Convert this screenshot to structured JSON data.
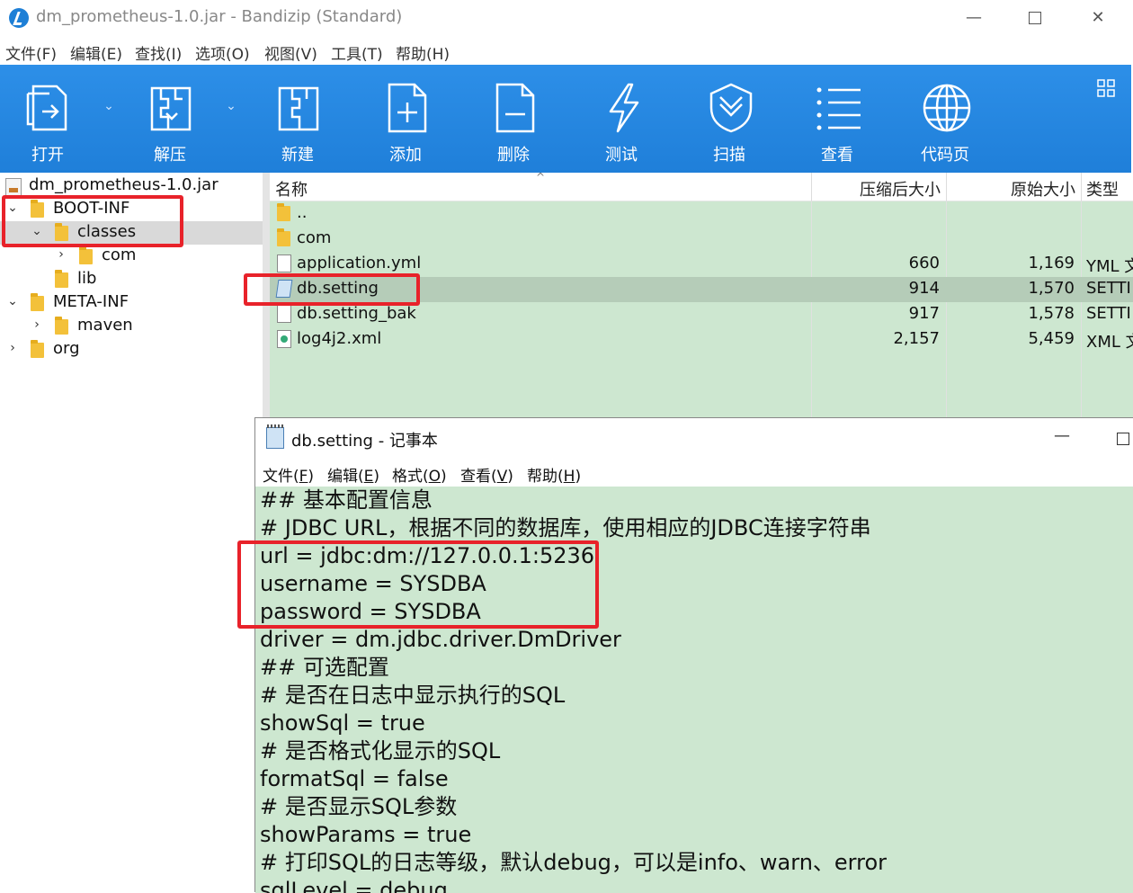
{
  "window": {
    "title": "dm_prometheus-1.0.jar - Bandizip (Standard)",
    "minimize": "—",
    "close": "✕"
  },
  "menu": [
    "文件(F)",
    "编辑(E)",
    "查找(I)",
    "选项(O)",
    "视图(V)",
    "工具(T)",
    "帮助(H)"
  ],
  "toolbar": {
    "open": "打开",
    "extract": "解压",
    "new": "新建",
    "add": "添加",
    "delete": "删除",
    "test": "测试",
    "scan": "扫描",
    "view": "查看",
    "codepage": "代码页",
    "dropdown": "⌄"
  },
  "tree": {
    "root": "dm_prometheus-1.0.jar",
    "items": [
      {
        "label": "BOOT-INF"
      },
      {
        "label": "classes"
      },
      {
        "label": "com"
      },
      {
        "label": "lib"
      },
      {
        "label": "META-INF"
      },
      {
        "label": "maven"
      },
      {
        "label": "org"
      }
    ]
  },
  "filelist": {
    "headers": {
      "name": "名称",
      "compressed": "压缩后大小",
      "original": "原始大小",
      "type": "类型"
    },
    "rows": [
      {
        "name": "..",
        "compressed": "",
        "original": "",
        "type": ""
      },
      {
        "name": "com",
        "compressed": "",
        "original": "",
        "type": ""
      },
      {
        "name": "application.yml",
        "compressed": "660",
        "original": "1,169",
        "type": "YML 文"
      },
      {
        "name": "db.setting",
        "compressed": "914",
        "original": "1,570",
        "type": "SETTI"
      },
      {
        "name": "db.setting_bak",
        "compressed": "917",
        "original": "1,578",
        "type": "SETTI"
      },
      {
        "name": "log4j2.xml",
        "compressed": "2,157",
        "original": "5,459",
        "type": "XML 文"
      }
    ]
  },
  "notepad": {
    "title": "db.setting - 记事本",
    "minimize": "—",
    "menu": [
      {
        "label": "文件(",
        "key": "F",
        "end": ")"
      },
      {
        "label": "编辑(",
        "key": "E",
        "end": ")"
      },
      {
        "label": "格式(",
        "key": "O",
        "end": ")"
      },
      {
        "label": "查看(",
        "key": "V",
        "end": ")"
      },
      {
        "label": "帮助(",
        "key": "H",
        "end": ")"
      }
    ],
    "lines": [
      "## 基本配置信息",
      "# JDBC URL，根据不同的数据库，使用相应的JDBC连接字符串",
      "url = jdbc:dm://127.0.0.1:5236",
      "username = SYSDBA",
      "password = SYSDBA",
      "driver = dm.jdbc.driver.DmDriver",
      "## 可选配置",
      "# 是否在日志中显示执行的SQL",
      "showSql = true",
      "# 是否格式化显示的SQL",
      "formatSql = false",
      "# 是否显示SQL参数",
      "showParams = true",
      "# 打印SQL的日志等级，默认debug，可以是info、warn、error",
      "sqlLevel = debug"
    ]
  },
  "colors": {
    "toolbar": "#2d8fe8",
    "list_bg": "#cde7d0",
    "selected_row": "#b5ccb8",
    "highlight": "#e8222a"
  }
}
